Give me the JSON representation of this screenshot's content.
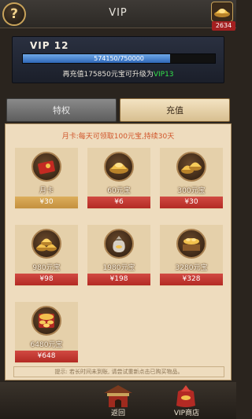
{
  "header": {
    "title": "VIP",
    "help_label": "?",
    "ingot_count": "2634"
  },
  "vip": {
    "level_label": "VIP 12",
    "progress_text": "574150/750000",
    "progress_value": 574150,
    "progress_max": 750000,
    "tip_prefix": "再充值175850元宝可升级为",
    "tip_next_level": "VIP13"
  },
  "tabs": [
    {
      "label": "特权",
      "active": false
    },
    {
      "label": "充值",
      "active": true
    }
  ],
  "monthly_note": "月卡:每天可领取100元宝,持续30天",
  "items": [
    {
      "icon": "red-envelope-card-icon",
      "name": "月卡",
      "price": "¥30",
      "price_style": "gold"
    },
    {
      "icon": "gold-ingot-icon",
      "name": "60元宝",
      "price": "¥6",
      "price_style": "red"
    },
    {
      "icon": "gold-ingot-pile-icon",
      "name": "300元宝",
      "price": "¥30",
      "price_style": "red"
    },
    {
      "icon": "gold-ingot-heap-icon",
      "name": "980元宝",
      "price": "¥98",
      "price_style": "red"
    },
    {
      "icon": "money-bag-icon",
      "name": "1980元宝",
      "price": "¥198",
      "price_style": "red"
    },
    {
      "icon": "treasure-chest-icon",
      "name": "3280元宝",
      "price": "¥328",
      "price_style": "red"
    },
    {
      "icon": "treasure-stack-icon",
      "name": "6480元宝",
      "price": "¥648",
      "price_style": "red"
    }
  ],
  "hint": "提示: 若长时间未到账, 请尝试重新点击已购买物品。",
  "nav": {
    "back_label": "返回",
    "shop_label": "VIP商店"
  },
  "colors": {
    "accent_gold": "#c9a35a",
    "price_red": "#b32a24",
    "price_gold": "#c4903e",
    "next_level_green": "#33e24a"
  }
}
